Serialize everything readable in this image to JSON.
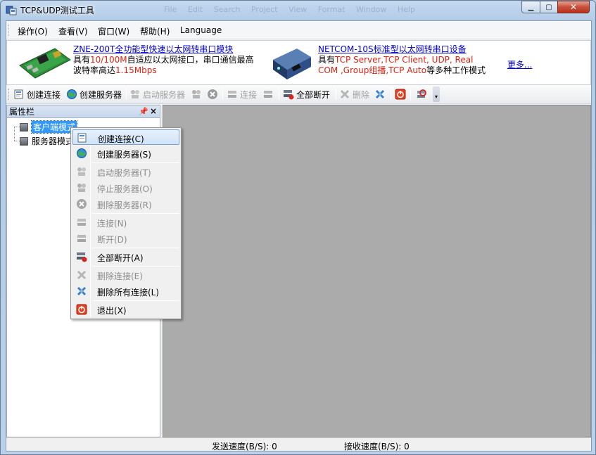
{
  "window": {
    "title": "TCP&UDP测试工具",
    "ghost_menu": "File   Edit   Search   Project   View   Format   Window   Help"
  },
  "menubar": {
    "items": [
      {
        "label": "操作(O)"
      },
      {
        "label": "查看(V)"
      },
      {
        "label": "窗口(W)"
      },
      {
        "label": "帮助(H)"
      },
      {
        "label": "Language"
      }
    ]
  },
  "ads": {
    "ad1": {
      "title": "ZNE-200T全功能型快速以太网转串口模块",
      "line2_a": "具有",
      "line2_b": "10/100M",
      "line2_c": "自适应以太网接口，串口通信最高",
      "line3_a": "波特率高达",
      "line3_b": "1.15Mbps"
    },
    "ad2": {
      "title": "NETCOM-10S标准型以太网转串口设备",
      "line2_a": "具有",
      "line2_b": "TCP Server,TCP Client, UDP, Real",
      "line3_b": "COM ,Group组播,TCP Auto",
      "line3_c": "等多种工作模式"
    },
    "more": "更多..."
  },
  "toolbar": {
    "create_connection": "创建连接",
    "create_server": "创建服务器",
    "start_server": "启动服务器",
    "connect": "连接",
    "disconnect_all": "全部断开",
    "delete": "删除"
  },
  "properties": {
    "title": "属性栏",
    "pin": "ᵖ",
    "close": "×",
    "nodes": [
      {
        "label": "客户端模式"
      },
      {
        "label": "服务器模式"
      }
    ]
  },
  "context_menu": {
    "items": [
      {
        "label": "创建连接(C)",
        "enabled": true
      },
      {
        "label": "创建服务器(S)",
        "enabled": true
      },
      {
        "label": "启动服务器(T)",
        "enabled": false
      },
      {
        "label": "停止服务器(O)",
        "enabled": false
      },
      {
        "label": "删除服务器(R)",
        "enabled": false
      },
      {
        "label": "连接(N)",
        "enabled": false
      },
      {
        "label": "断开(D)",
        "enabled": false
      },
      {
        "label": "全部断开(A)",
        "enabled": true
      },
      {
        "label": "删除连接(E)",
        "enabled": false
      },
      {
        "label": "删除所有连接(L)",
        "enabled": true
      },
      {
        "label": "退出(X)",
        "enabled": true
      }
    ]
  },
  "statusbar": {
    "send_speed": "发送速度(B/S): 0",
    "recv_speed": "接收速度(B/S): 0"
  },
  "colors": {
    "selection": "#3399ff",
    "ad_red": "#e02010",
    "ad_link": "#0000cc",
    "mdi_background": "#ababab"
  }
}
